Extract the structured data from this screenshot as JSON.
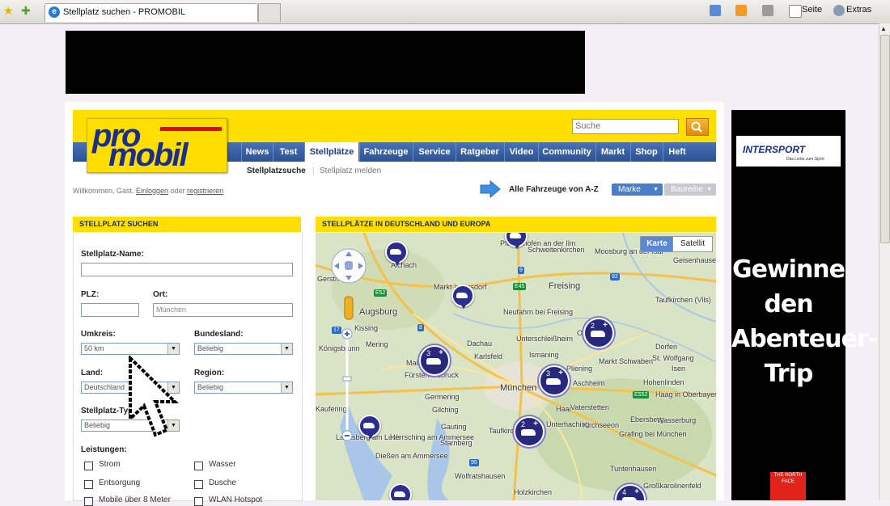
{
  "browser": {
    "tab_title": "Stellplatz suchen - PROMOBIL",
    "toolbar_seite": "Seite",
    "toolbar_extras": "Extras"
  },
  "header": {
    "logo_line1": "pro",
    "logo_line2": "mobil",
    "search_placeholder": "Suche"
  },
  "nav": {
    "items": [
      "News",
      "Test",
      "Stellplätze",
      "Fahrzeuge",
      "Service",
      "Ratgeber",
      "Video",
      "Community",
      "Markt",
      "Shop",
      "Heft"
    ],
    "active": "Stellplätze",
    "sub_items": [
      "Stellplatzsuche",
      "Stellplatz melden"
    ]
  },
  "account": {
    "welcome": "Willkommen, Gast.",
    "login": "Einloggen",
    "or": "oder",
    "register": "registrieren"
  },
  "vehicles": {
    "all_label": "Alle Fahrzeuge von A-Z",
    "marke": "Marke",
    "baureihe": "Baureihe"
  },
  "search_panel": {
    "title": "STELLPLATZ SUCHEN",
    "name_label": "Stellplatz-Name:",
    "name_value": "",
    "plz_label": "PLZ:",
    "plz_value": "",
    "ort_label": "Ort:",
    "ort_placeholder": "München",
    "umkreis_label": "Umkreis:",
    "umkreis_value": "50 km",
    "bundesland_label": "Bundesland:",
    "bundesland_value": "Beliebig",
    "land_label": "Land:",
    "land_value": "Deutschland",
    "region_label": "Region:",
    "region_value": "Beliebig",
    "typ_label": "Stellplatz-Typ:",
    "typ_value": "Beliebig",
    "leistungen_label": "Leistungen:",
    "leistungen": [
      "Strom",
      "Wasser",
      "Entsorgung",
      "Dusche",
      "Mobile über 8 Meter",
      "WLAN Hotspot"
    ]
  },
  "map_panel": {
    "title": "STELLPLÄTZE IN DEUTSCHLAND UND EUROPA",
    "map_button": "Karte",
    "satellite_button": "Satellit",
    "places": [
      "Pfaffenhofen an der Ilm",
      "Schweitenkirchen",
      "Moosburg an der Isar",
      "Geisenhausen",
      "Aichach",
      "Gersthofen",
      "Markt Indersdorf",
      "Freising",
      "Augsburg",
      "Neufahrn bei Freising",
      "Taufkirchen (Vils)",
      "Kissing",
      "Unterschleißheim",
      "Oberding",
      "Dachau",
      "Karlsfeld",
      "Ismaning",
      "Dorfen",
      "Königsbrunn",
      "Mering",
      "Maisach",
      "Fürstenfeldbruck",
      "Markt Schwaben",
      "St. Wolfgang",
      "Isen",
      "München",
      "Pliening",
      "Aschheim",
      "Haar",
      "Vaterstetten",
      "Germering",
      "Gilching",
      "Taufkirchen",
      "Hohenlinden",
      "Haag in Oberbayern",
      "Kaufering",
      "Gauting",
      "Ebersberg",
      "Wasserburg",
      "Landsberg am Lech",
      "Herrsching am Ammersee",
      "Starnberg",
      "Unterhaching",
      "Kirchseeon",
      "Grafing bei München",
      "Dießen am Ammersee",
      "Wolfratshausen",
      "Holzkirchen",
      "Tuntenhausen",
      "Großkarolinenfeld"
    ],
    "road_labels": [
      "9",
      "92",
      "E45",
      "E52",
      "8",
      "17",
      "E552",
      "95"
    ],
    "clusters": [
      "2",
      "3",
      "3",
      "2",
      "4"
    ]
  },
  "ad": {
    "brand": "INTERSPORT",
    "brand_sub": "Das Liebe zum Sport",
    "claim": "Gewinne den Abenteuer-Trip",
    "brand2": "THE NORTH FACE"
  },
  "colors": {
    "header_yellow": "#ffde00",
    "nav_blue": "#2b5195",
    "marker_blue": "#2b2d8f"
  }
}
